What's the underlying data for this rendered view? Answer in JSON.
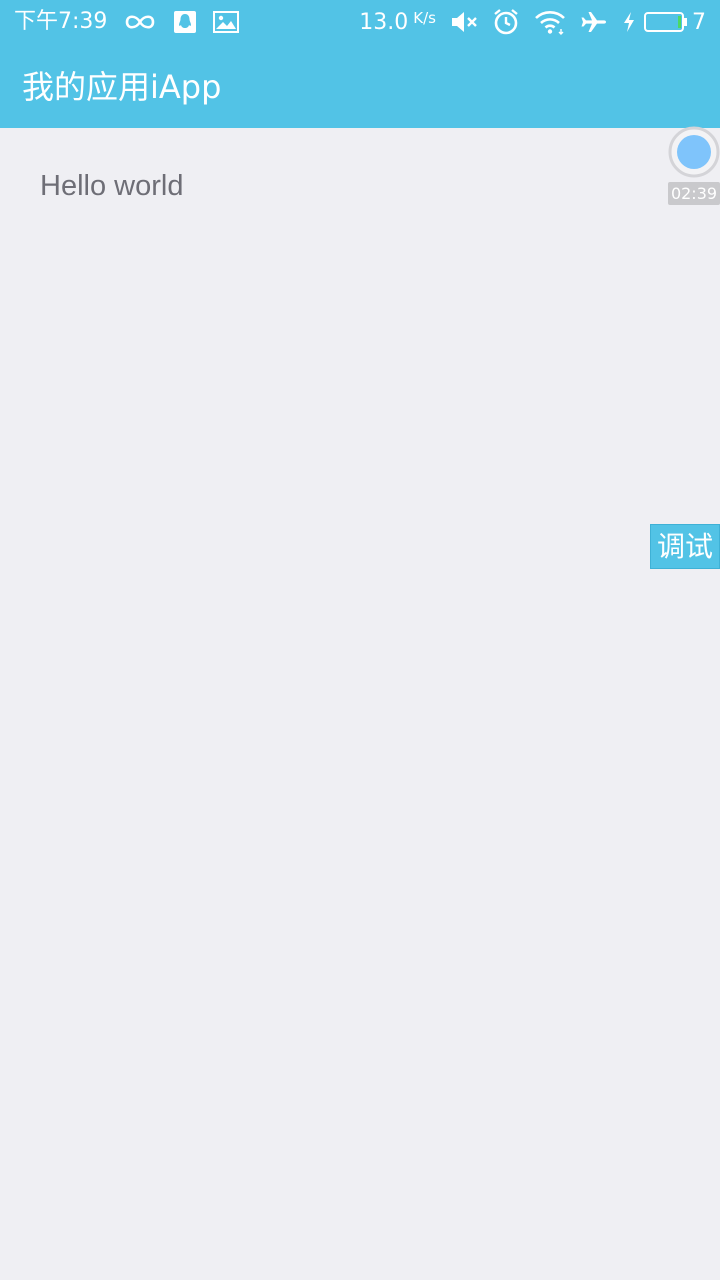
{
  "status_bar": {
    "time": "下午7:39",
    "left_icons": [
      "infinity-icon",
      "qq-icon",
      "image-icon"
    ],
    "net_speed": "13.0",
    "net_speed_unit": "K/s",
    "right_icons": [
      "mute-icon",
      "alarm-icon",
      "wifi-icon",
      "airplane-icon",
      "charging-icon",
      "battery-icon"
    ],
    "battery": "7",
    "battery_level": 0.07,
    "battery_fill_color": "#4cd964"
  },
  "app_bar": {
    "title": "我的应用iApp",
    "color": "#52c3e6"
  },
  "content": {
    "text": "Hello world"
  },
  "recorder": {
    "time": "02:39",
    "dot_color": "#7fc4fb"
  },
  "debug_button": {
    "label": "调试"
  }
}
